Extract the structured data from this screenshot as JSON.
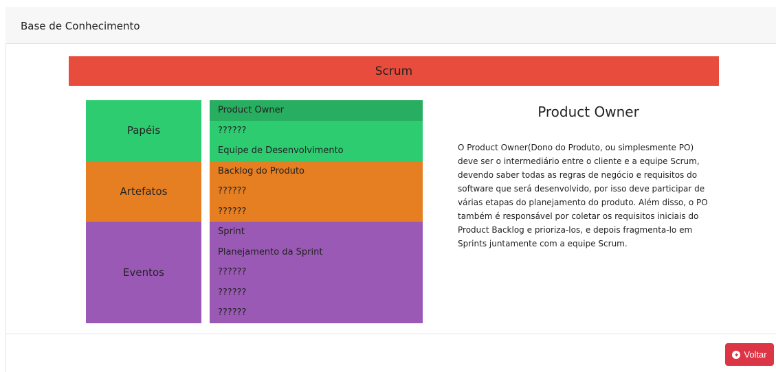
{
  "header": {
    "title": "Base de Conhecimento"
  },
  "banner": {
    "title": "Scrum"
  },
  "groups": [
    {
      "label": "Papéis",
      "color": "#2ecc71",
      "items": [
        "Product Owner",
        "??????",
        "Equipe de Desenvolvimento"
      ],
      "active_index": 0,
      "active_color": "#27ae60"
    },
    {
      "label": "Artefatos",
      "color": "#e67e22",
      "items": [
        "Backlog do Produto",
        "??????",
        "??????"
      ]
    },
    {
      "label": "Eventos",
      "color": "#9b59b6",
      "items": [
        "Sprint",
        "Planejamento da Sprint",
        "??????",
        "??????",
        "??????"
      ]
    }
  ],
  "detail": {
    "title": "Product Owner",
    "lines": [
      "O Product Owner(Dono do Produto, ou simplesmente PO)",
      "deve ser o intermediário entre o cliente e a equipe Scrum,",
      "devendo saber todas as regras de negócio e requisitos do",
      "software que será desenvolvido, por isso deve participar de",
      "várias etapas do planejamento do produto. Além disso, o PO",
      "também é responsável por coletar os requisitos iniciais do",
      "Product Backlog e prioriza-los, e depois fragmenta-lo em",
      "Sprints juntamente com a equipe Scrum."
    ]
  },
  "footer": {
    "back_label": "Voltar",
    "back_icon": "arrow-circle-left-icon",
    "back_color": "#dc3545"
  },
  "colors": {
    "banner": "#e74c3c",
    "header_bg": "#f7f7f7"
  }
}
